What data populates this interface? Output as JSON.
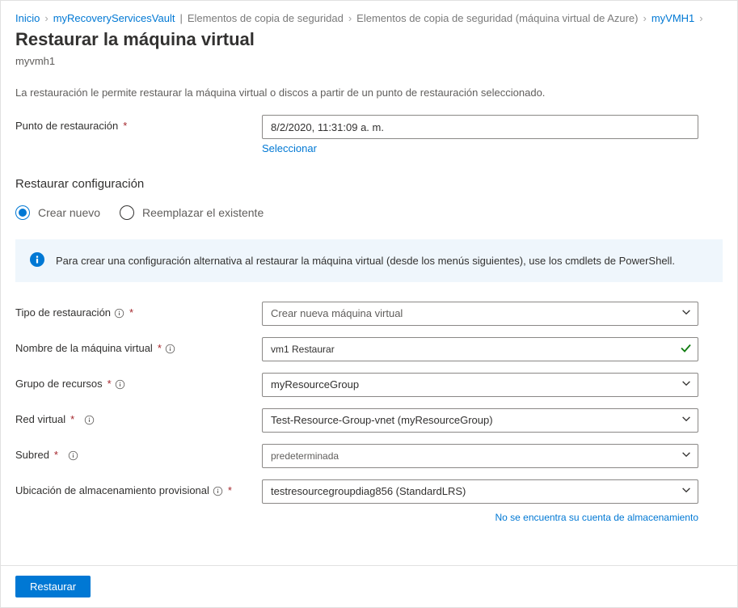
{
  "breadcrumb": {
    "home": "Inicio",
    "vault": "myRecoveryServicesVault",
    "sep1": "|",
    "items1": "Elementos de copia de seguridad",
    "items2": "Elementos de copia de seguridad (máquina virtual de Azure)",
    "vm": "myVMH1"
  },
  "page": {
    "title": "Restaurar la máquina virtual",
    "subtitle": "myvmh1",
    "desc": "La restauración le permite restaurar la máquina virtual o discos a partir de un punto de restauración seleccionado."
  },
  "restore_point": {
    "label": "Punto de restauración",
    "label_req": "*",
    "value": "8/2/2020, 11:31:09 a. m.",
    "select_link": "Seleccionar"
  },
  "config_section": {
    "title": "Restaurar configuración",
    "radio_new": "Crear nuevo",
    "radio_replace": "Reemplazar el existente"
  },
  "info_banner": "Para crear una configuración alternativa al restaurar la máquina virtual (desde los menús siguientes), use los cmdlets de PowerShell.",
  "fields": {
    "restore_type_label": "Tipo de restauración",
    "restore_type_req": "*",
    "restore_type_value": "Crear nueva máquina virtual",
    "vm_name_label": "Nombre de la máquina virtual",
    "vm_name_req": "*",
    "vm_name_value": "vm1 Restaurar",
    "rg_label": "Grupo de recursos",
    "rg_req": "*",
    "rg_value": "myResourceGroup",
    "vnet_label": "Red virtual",
    "vnet_req": "*",
    "vnet_value": "Test-Resource-Group-vnet (myResourceGroup)",
    "subnet_label": "Subred",
    "subnet_req": "*",
    "subnet_value": "predeterminada",
    "staging_label": "Ubicación de almacenamiento provisional",
    "staging_req": "*",
    "staging_value": "testresourcegroupdiag856 (StandardLRS)",
    "storage_link": "No se encuentra su cuenta de almacenamiento"
  },
  "footer": {
    "restore_btn": "Restaurar"
  }
}
